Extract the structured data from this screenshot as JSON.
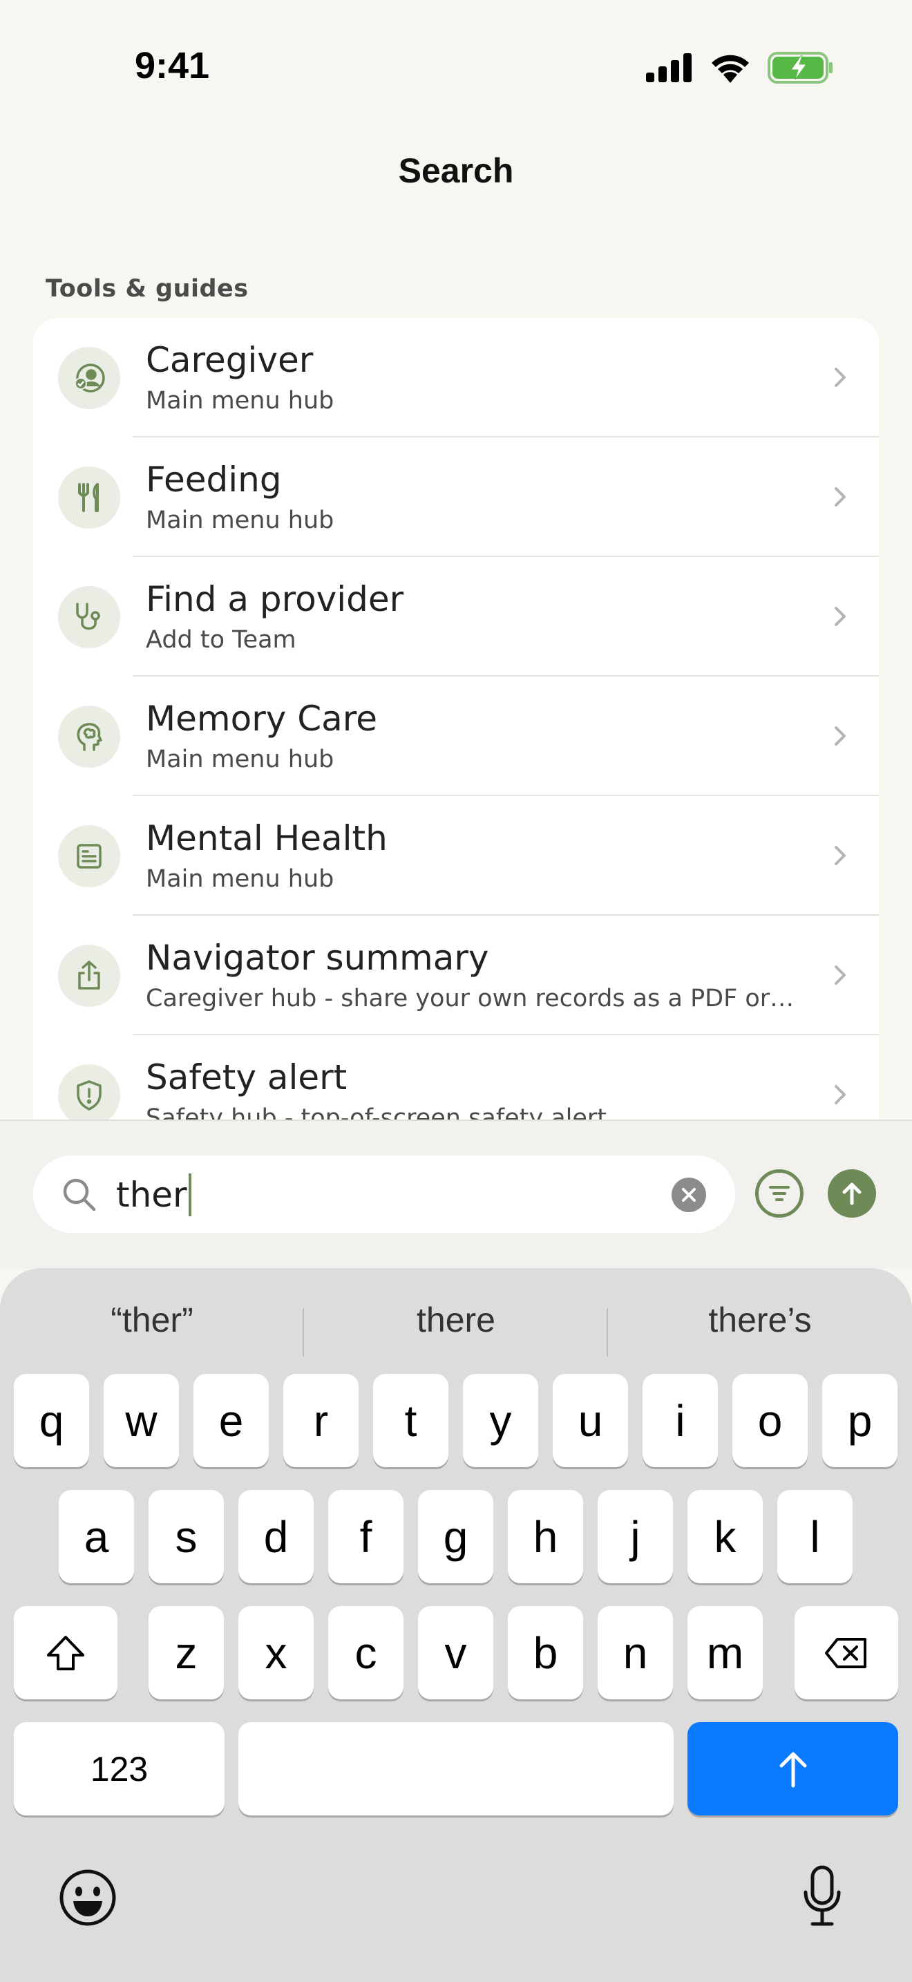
{
  "status_bar": {
    "time": "9:41",
    "icons": [
      "cellular-signal-icon",
      "wifi-icon",
      "battery-charging-icon"
    ]
  },
  "header": {
    "title": "Search"
  },
  "section": {
    "label": "Tools & guides"
  },
  "results": [
    {
      "title": "Caregiver",
      "subtitle": "Main menu hub",
      "icon": "caregiver-icon"
    },
    {
      "title": "Feeding",
      "subtitle": "Main menu hub",
      "icon": "fork-knife-icon"
    },
    {
      "title": "Find a provider",
      "subtitle": "Add to Team",
      "icon": "stethoscope-icon"
    },
    {
      "title": "Memory Care",
      "subtitle": "Main menu hub",
      "icon": "head-brain-icon"
    },
    {
      "title": "Mental Health",
      "subtitle": "Main menu hub",
      "icon": "clipboard-icon"
    },
    {
      "title": "Navigator summary",
      "subtitle": "Caregiver hub - share your own records as a PDF or…",
      "icon": "share-icon"
    },
    {
      "title": "Safety alert",
      "subtitle": "Safety hub - top-of-screen safety alert",
      "icon": "shield-alert-icon"
    }
  ],
  "search": {
    "value": "ther"
  },
  "keyboard": {
    "suggestions": [
      "“ther”",
      "there",
      "there’s"
    ],
    "row1": [
      "q",
      "w",
      "e",
      "r",
      "t",
      "y",
      "u",
      "i",
      "o",
      "p"
    ],
    "row2": [
      "a",
      "s",
      "d",
      "f",
      "g",
      "h",
      "j",
      "k",
      "l"
    ],
    "row3": [
      "z",
      "x",
      "c",
      "v",
      "b",
      "n",
      "m"
    ],
    "numbers_label": "123"
  },
  "colors": {
    "accent": "#6d8a57",
    "return_key": "#0a7aff",
    "icon_bg": "#e9ede4"
  }
}
